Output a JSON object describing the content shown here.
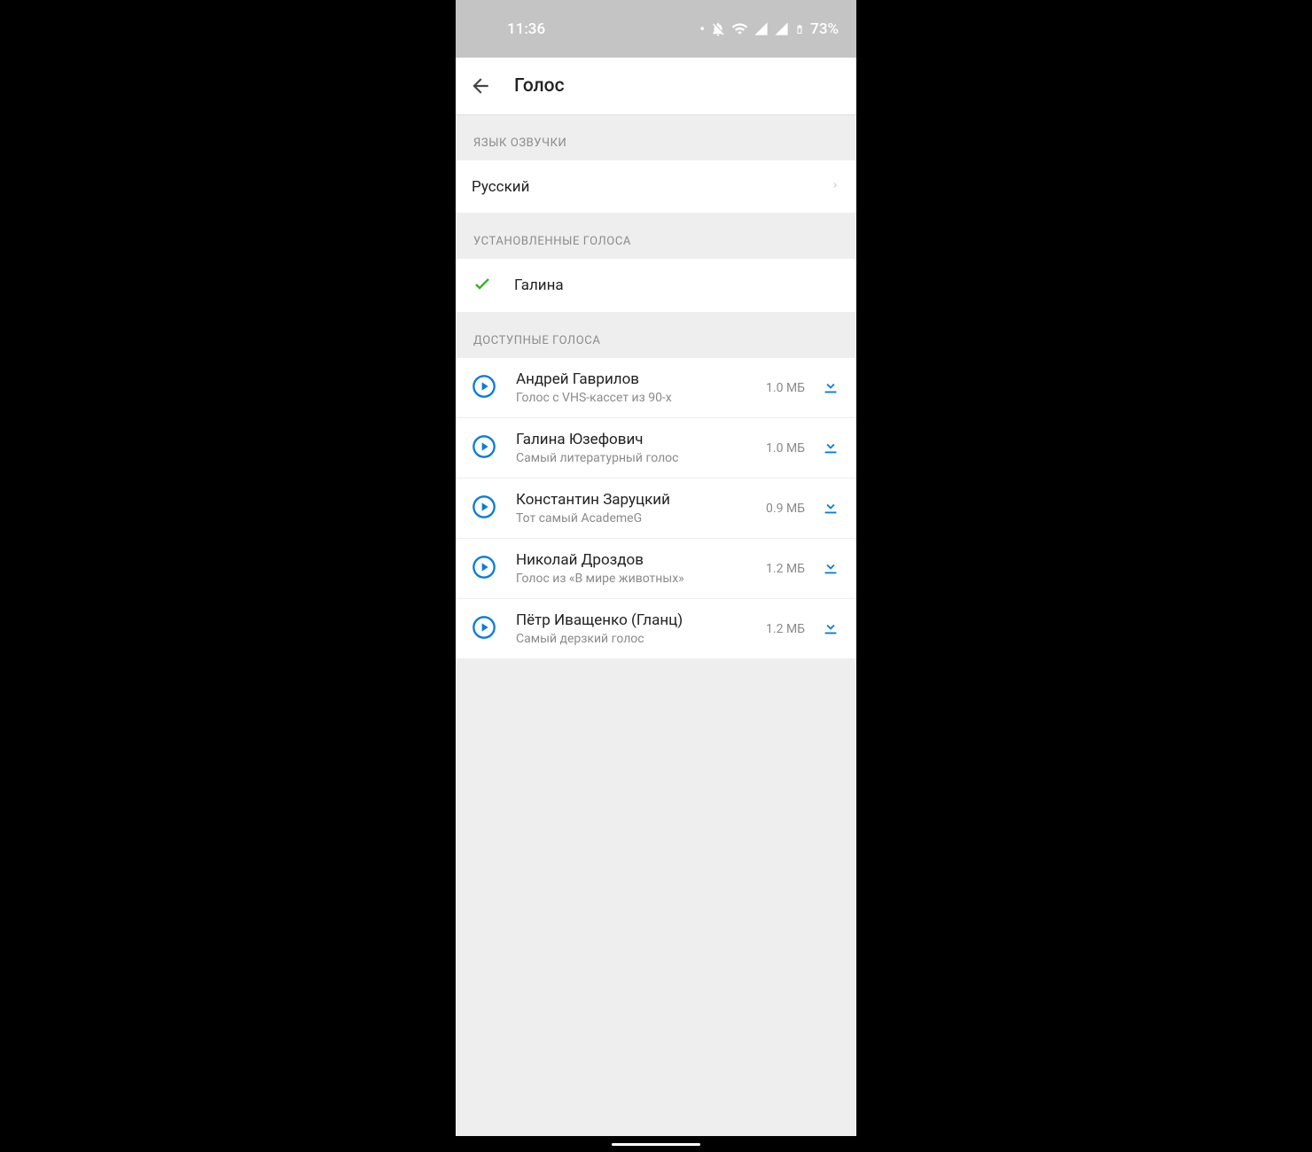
{
  "status": {
    "time": "11:36",
    "battery": "73%"
  },
  "app_bar": {
    "title": "Голос"
  },
  "sections": {
    "language_header": "ЯЗЫК ОЗВУЧКИ",
    "language_value": "Русский",
    "installed_header": "УСТАНОВЛЕННЫЕ ГОЛОСА",
    "installed_voice": "Галина",
    "available_header": "ДОСТУПНЫЕ ГОЛОСА"
  },
  "available_voices": [
    {
      "name": "Андрей Гаврилов",
      "desc": "Голос с VHS-кассет из 90-х",
      "size": "1.0 МБ"
    },
    {
      "name": "Галина Юзефович",
      "desc": "Самый литературный голос",
      "size": "1.0 МБ"
    },
    {
      "name": "Константин Заруцкий",
      "desc": "Тот самый AcademeG",
      "size": "0.9 МБ"
    },
    {
      "name": "Николай Дроздов",
      "desc": "Голос из «В мире животных»",
      "size": "1.2 МБ"
    },
    {
      "name": "Пётр Иващенко (Гланц)",
      "desc": "Самый дерзкий голос",
      "size": "1.2 МБ"
    }
  ]
}
